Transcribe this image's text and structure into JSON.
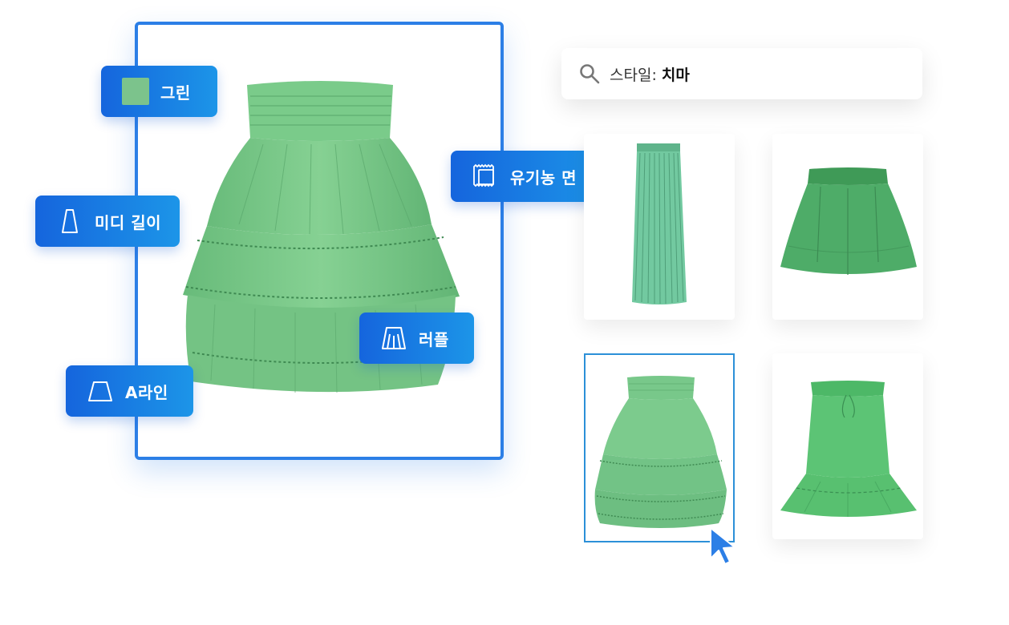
{
  "attributes": {
    "color": {
      "label": "그린",
      "swatch": "#7cc38c"
    },
    "length": {
      "label": "미디 길이",
      "icon": "midi-length-icon"
    },
    "fabric": {
      "label": "유기농 면",
      "icon": "fabric-icon"
    },
    "detail": {
      "label": "러플",
      "icon": "ruffle-icon"
    },
    "shape": {
      "label": "A라인",
      "icon": "a-line-icon"
    }
  },
  "search": {
    "key": "스타일:",
    "value": "치마"
  },
  "results": [
    {
      "name": "pleated-maxi-skirt",
      "color": "#6fc49a"
    },
    {
      "name": "green-mini-skirt",
      "color": "#49a864"
    },
    {
      "name": "tiered-ruffle-skirt",
      "color": "#72c487",
      "selected": true
    },
    {
      "name": "drawstring-ruffle-skirt",
      "color": "#5cc475"
    }
  ],
  "colors": {
    "accent": "#2c7fe6",
    "tag_gradient_start": "#1565dd",
    "tag_gradient_end": "#1c95e8",
    "skirt_green": "#7ccb8b"
  }
}
